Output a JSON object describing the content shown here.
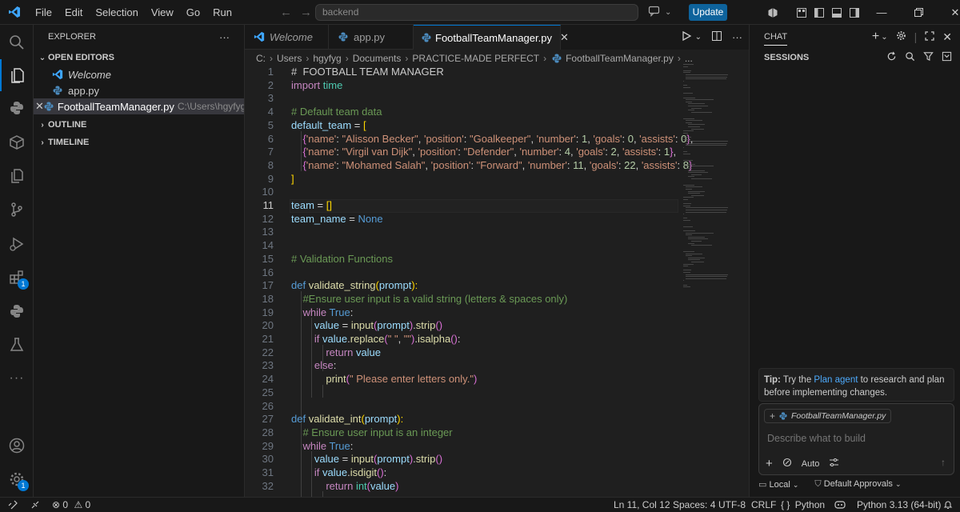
{
  "titlebar": {
    "menu": [
      "File",
      "Edit",
      "Selection",
      "View",
      "Go",
      "Run"
    ],
    "search": "backend",
    "update_label": "Update"
  },
  "activity": {
    "extensions_badge": "1",
    "accounts_badge": "1"
  },
  "sidebar": {
    "title": "EXPLORER",
    "more": "···",
    "open_editors_label": "OPEN EDITORS",
    "open_editors": [
      {
        "name": "Welcome",
        "kind": "vscode"
      },
      {
        "name": "app.py",
        "kind": "python"
      },
      {
        "name": "FootballTeamManager.py",
        "kind": "python",
        "path": "C:\\Users\\hgyfyg\\..."
      }
    ],
    "outline_label": "OUTLINE",
    "timeline_label": "TIMELINE"
  },
  "editor": {
    "tabs": [
      {
        "label": "Welcome",
        "kind": "vscode"
      },
      {
        "label": "app.py",
        "kind": "python"
      },
      {
        "label": "FootballTeamManager.py",
        "kind": "python",
        "active": true
      }
    ],
    "breadcrumb": [
      "C:",
      "Users",
      "hgyfyg",
      "Documents",
      "PRACTICE-MADE PERFECT",
      "FootballTeamManager.py",
      "..."
    ],
    "current_line": 11,
    "lines": [
      [
        [
          "#  FOOTBALL TEAM MANAGER",
          "#cccccc"
        ]
      ],
      [
        [
          "import",
          "#c586c0"
        ],
        [
          " time",
          "#4ec9b0"
        ]
      ],
      [],
      [
        [
          "# Default team data",
          "#6a9955"
        ]
      ],
      [
        [
          "default_team",
          "#9cdcfe"
        ],
        [
          " = ",
          "#d4d4d4"
        ],
        [
          "[",
          "#ffd700"
        ]
      ],
      [
        [
          "    ",
          ""
        ],
        [
          "{",
          "#da70d6"
        ],
        [
          "'name'",
          "#ce9178"
        ],
        [
          ": ",
          "#d4d4d4"
        ],
        [
          "\"Alisson Becker\"",
          "#ce9178"
        ],
        [
          ", ",
          "#d4d4d4"
        ],
        [
          "'position'",
          "#ce9178"
        ],
        [
          ": ",
          "#d4d4d4"
        ],
        [
          "\"Goalkeeper\"",
          "#ce9178"
        ],
        [
          ", ",
          "#d4d4d4"
        ],
        [
          "'number'",
          "#ce9178"
        ],
        [
          ": ",
          "#d4d4d4"
        ],
        [
          "1",
          "#b5cea8"
        ],
        [
          ", ",
          "#d4d4d4"
        ],
        [
          "'goals'",
          "#ce9178"
        ],
        [
          ": ",
          "#d4d4d4"
        ],
        [
          "0",
          "#b5cea8"
        ],
        [
          ", ",
          "#d4d4d4"
        ],
        [
          "'assists'",
          "#ce9178"
        ],
        [
          ": ",
          "#d4d4d4"
        ],
        [
          "0",
          "#b5cea8"
        ],
        [
          "}",
          "#da70d6"
        ],
        [
          ",",
          "#d4d4d4"
        ]
      ],
      [
        [
          "    ",
          ""
        ],
        [
          "{",
          "#da70d6"
        ],
        [
          "'name'",
          "#ce9178"
        ],
        [
          ": ",
          "#d4d4d4"
        ],
        [
          "\"Virgil van Dijk\"",
          "#ce9178"
        ],
        [
          ", ",
          "#d4d4d4"
        ],
        [
          "'position'",
          "#ce9178"
        ],
        [
          ": ",
          "#d4d4d4"
        ],
        [
          "\"Defender\"",
          "#ce9178"
        ],
        [
          ", ",
          "#d4d4d4"
        ],
        [
          "'number'",
          "#ce9178"
        ],
        [
          ": ",
          "#d4d4d4"
        ],
        [
          "4",
          "#b5cea8"
        ],
        [
          ", ",
          "#d4d4d4"
        ],
        [
          "'goals'",
          "#ce9178"
        ],
        [
          ": ",
          "#d4d4d4"
        ],
        [
          "2",
          "#b5cea8"
        ],
        [
          ", ",
          "#d4d4d4"
        ],
        [
          "'assists'",
          "#ce9178"
        ],
        [
          ": ",
          "#d4d4d4"
        ],
        [
          "1",
          "#b5cea8"
        ],
        [
          "}",
          "#da70d6"
        ],
        [
          ",",
          "#d4d4d4"
        ]
      ],
      [
        [
          "    ",
          ""
        ],
        [
          "{",
          "#da70d6"
        ],
        [
          "'name'",
          "#ce9178"
        ],
        [
          ": ",
          "#d4d4d4"
        ],
        [
          "\"Mohamed Salah\"",
          "#ce9178"
        ],
        [
          ", ",
          "#d4d4d4"
        ],
        [
          "'position'",
          "#ce9178"
        ],
        [
          ": ",
          "#d4d4d4"
        ],
        [
          "\"Forward\"",
          "#ce9178"
        ],
        [
          ", ",
          "#d4d4d4"
        ],
        [
          "'number'",
          "#ce9178"
        ],
        [
          ": ",
          "#d4d4d4"
        ],
        [
          "11",
          "#b5cea8"
        ],
        [
          ", ",
          "#d4d4d4"
        ],
        [
          "'goals'",
          "#ce9178"
        ],
        [
          ": ",
          "#d4d4d4"
        ],
        [
          "22",
          "#b5cea8"
        ],
        [
          ", ",
          "#d4d4d4"
        ],
        [
          "'assists'",
          "#ce9178"
        ],
        [
          ": ",
          "#d4d4d4"
        ],
        [
          "8",
          "#b5cea8"
        ],
        [
          "}",
          "#da70d6"
        ]
      ],
      [
        [
          "]",
          "#ffd700"
        ]
      ],
      [],
      [
        [
          "team",
          "#9cdcfe"
        ],
        [
          " = ",
          "#d4d4d4"
        ],
        [
          "[]",
          "#ffd700"
        ]
      ],
      [
        [
          "team_name",
          "#9cdcfe"
        ],
        [
          " = ",
          "#d4d4d4"
        ],
        [
          "None",
          "#569cd6"
        ]
      ],
      [],
      [],
      [
        [
          "# Validation Functions",
          "#6a9955"
        ]
      ],
      [],
      [
        [
          "def",
          "#569cd6"
        ],
        [
          " ",
          ""
        ],
        [
          "validate_string",
          "#dcdcaa"
        ],
        [
          "(",
          "#ffd700"
        ],
        [
          "prompt",
          "#9cdcfe"
        ],
        [
          "):",
          "#ffd700"
        ]
      ],
      [
        [
          "    ",
          ""
        ],
        [
          "#Ensure user input is a valid string (letters & spaces only)",
          "#6a9955"
        ]
      ],
      [
        [
          "    ",
          ""
        ],
        [
          "while",
          "#c586c0"
        ],
        [
          " ",
          ""
        ],
        [
          "True",
          "#569cd6"
        ],
        [
          ":",
          "#d4d4d4"
        ]
      ],
      [
        [
          "        ",
          ""
        ],
        [
          "value",
          "#9cdcfe"
        ],
        [
          " = ",
          "#d4d4d4"
        ],
        [
          "input",
          "#dcdcaa"
        ],
        [
          "(",
          "#da70d6"
        ],
        [
          "prompt",
          "#9cdcfe"
        ],
        [
          ")",
          "#da70d6"
        ],
        [
          ".",
          "#d4d4d4"
        ],
        [
          "strip",
          "#dcdcaa"
        ],
        [
          "()",
          "#da70d6"
        ]
      ],
      [
        [
          "        ",
          ""
        ],
        [
          "if",
          "#c586c0"
        ],
        [
          " ",
          ""
        ],
        [
          "value",
          "#9cdcfe"
        ],
        [
          ".",
          "#d4d4d4"
        ],
        [
          "replace",
          "#dcdcaa"
        ],
        [
          "(",
          "#da70d6"
        ],
        [
          "\" \"",
          "#ce9178"
        ],
        [
          ", ",
          "#d4d4d4"
        ],
        [
          "\"\"",
          "#ce9178"
        ],
        [
          ")",
          "#da70d6"
        ],
        [
          ".",
          "#d4d4d4"
        ],
        [
          "isalpha",
          "#dcdcaa"
        ],
        [
          "()",
          "#da70d6"
        ],
        [
          ":",
          "#d4d4d4"
        ]
      ],
      [
        [
          "            ",
          ""
        ],
        [
          "return",
          "#c586c0"
        ],
        [
          " ",
          ""
        ],
        [
          "value",
          "#9cdcfe"
        ]
      ],
      [
        [
          "        ",
          ""
        ],
        [
          "else",
          "#c586c0"
        ],
        [
          ":",
          "#d4d4d4"
        ]
      ],
      [
        [
          "            ",
          ""
        ],
        [
          "print",
          "#dcdcaa"
        ],
        [
          "(",
          "#da70d6"
        ],
        [
          "\" Please enter letters only.\"",
          "#ce9178"
        ],
        [
          ")",
          "#da70d6"
        ]
      ],
      [],
      [],
      [
        [
          "def",
          "#569cd6"
        ],
        [
          " ",
          ""
        ],
        [
          "validate_int",
          "#dcdcaa"
        ],
        [
          "(",
          "#ffd700"
        ],
        [
          "prompt",
          "#9cdcfe"
        ],
        [
          "):",
          "#ffd700"
        ]
      ],
      [
        [
          "    ",
          ""
        ],
        [
          "# Ensure user input is an integer",
          "#6a9955"
        ]
      ],
      [
        [
          "    ",
          ""
        ],
        [
          "while",
          "#c586c0"
        ],
        [
          " ",
          ""
        ],
        [
          "True",
          "#569cd6"
        ],
        [
          ":",
          "#d4d4d4"
        ]
      ],
      [
        [
          "        ",
          ""
        ],
        [
          "value",
          "#9cdcfe"
        ],
        [
          " = ",
          "#d4d4d4"
        ],
        [
          "input",
          "#dcdcaa"
        ],
        [
          "(",
          "#da70d6"
        ],
        [
          "prompt",
          "#9cdcfe"
        ],
        [
          ")",
          "#da70d6"
        ],
        [
          ".",
          "#d4d4d4"
        ],
        [
          "strip",
          "#dcdcaa"
        ],
        [
          "()",
          "#da70d6"
        ]
      ],
      [
        [
          "        ",
          ""
        ],
        [
          "if",
          "#c586c0"
        ],
        [
          " ",
          ""
        ],
        [
          "value",
          "#9cdcfe"
        ],
        [
          ".",
          "#d4d4d4"
        ],
        [
          "isdigit",
          "#dcdcaa"
        ],
        [
          "()",
          "#da70d6"
        ],
        [
          ":",
          "#d4d4d4"
        ]
      ],
      [
        [
          "            ",
          ""
        ],
        [
          "return",
          "#c586c0"
        ],
        [
          " ",
          ""
        ],
        [
          "int",
          "#4ec9b0"
        ],
        [
          "(",
          "#da70d6"
        ],
        [
          "value",
          "#9cdcfe"
        ],
        [
          ")",
          "#da70d6"
        ]
      ]
    ]
  },
  "chat": {
    "title": "CHAT",
    "sessions_label": "SESSIONS",
    "tip_prefix": "Tip:",
    "tip_text_1": " Try the ",
    "tip_link": "Plan agent",
    "tip_text_2": " to research and plan before implementing changes.",
    "attachment": "FootballTeamManager.py",
    "input_placeholder": "Describe what to build",
    "mode_label": "Auto",
    "location_label": "Local",
    "approvals_label": "Default Approvals"
  },
  "statusbar": {
    "errors": "0",
    "warnings": "0",
    "position": "Ln 11, Col 12",
    "spaces": "Spaces: 4",
    "encoding": "UTF-8",
    "eol": "CRLF",
    "language": "Python",
    "interpreter": "Python 3.13 (64-bit)"
  }
}
